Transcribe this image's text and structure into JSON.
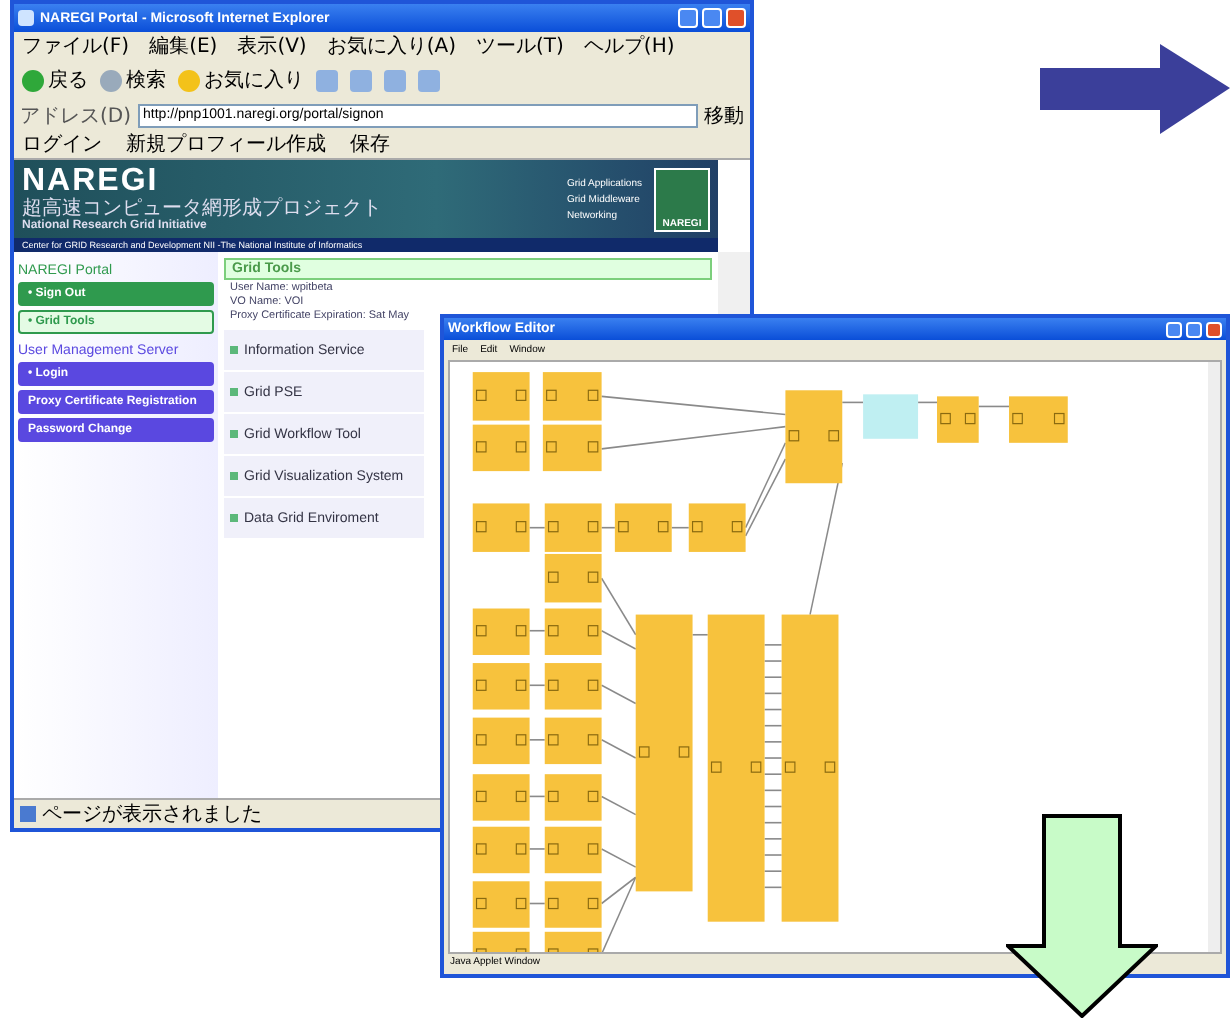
{
  "browser": {
    "title": "NAREGI Portal - Microsoft Internet Explorer",
    "menu": [
      "ファイル(F)",
      "編集(E)",
      "表示(V)",
      "お気に入り(A)",
      "ツール(T)",
      "ヘルプ(H)"
    ],
    "toolbar": [
      "戻る",
      "検索",
      "お気に入り"
    ],
    "address": {
      "label": "アドレス(D)",
      "url": "http://pnp1001.naregi.org/portal/signon",
      "go": "移動"
    },
    "links": [
      "ログイン",
      "新規プロフィール作成",
      "保存"
    ],
    "banner": {
      "logo": "NAREGI",
      "japanese": "超高速コンピュータ網形成プロジェクト",
      "english": "National Research Grid Initiative",
      "layers": [
        "Grid Applications",
        "Grid Middleware",
        "Networking"
      ],
      "footer": "Center for GRID Research and Development   NII -The National Institute of Informatics",
      "badge": "NAREGI"
    },
    "sidebar": [
      {
        "title": "NAREGI Portal",
        "color": "#2f9a4e",
        "items": [
          {
            "label": "• Sign Out",
            "kind": "filled"
          },
          {
            "label": "• Grid Tools",
            "kind": "outline"
          }
        ]
      },
      {
        "title": "User Management Server",
        "color": "#5a48e0",
        "items": [
          {
            "label": "• Login",
            "kind": "filled"
          },
          {
            "label": "Proxy Certificate Registration",
            "kind": "filled"
          },
          {
            "label": "Password Change",
            "kind": "filled"
          }
        ]
      }
    ],
    "main": {
      "header": "Grid Tools",
      "info": [
        "User Name: wpitbeta",
        "VO Name: VOI",
        "Proxy Certificate Expiration: Sat May"
      ],
      "tools": [
        "Information Service",
        "Grid PSE",
        "Grid Workflow Tool",
        "Grid Visualization System",
        "Data Grid Enviroment"
      ]
    },
    "status": "ページが表示されました"
  },
  "editor": {
    "title": "Workflow Editor",
    "menu": [
      "File",
      "Edit",
      "Window"
    ],
    "status": "Java Applet Window"
  }
}
